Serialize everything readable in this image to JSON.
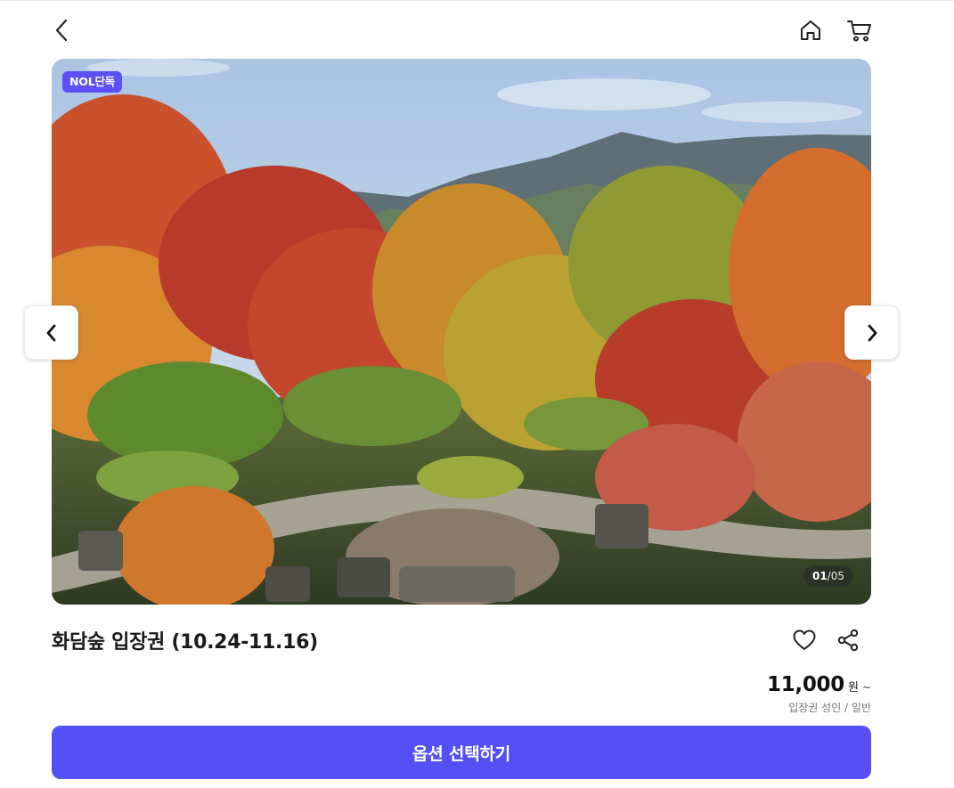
{
  "header": {
    "back_icon": "chevron-left-icon",
    "home_icon": "home-icon",
    "cart_icon": "cart-icon"
  },
  "gallery": {
    "badge": "NOL단독",
    "current": "01",
    "separator": "/",
    "total": "05",
    "prev_icon": "chevron-left-icon",
    "next_icon": "chevron-right-icon"
  },
  "product": {
    "title": "화담숲 입장권 (10.24-11.16)",
    "like_icon": "heart-icon",
    "share_icon": "share-icon",
    "price": "11,000",
    "price_unit": "원",
    "price_suffix": "~",
    "price_desc": "입장권 성인 / 일반"
  },
  "cta": {
    "label": "옵션 선택하기"
  },
  "colors": {
    "accent": "#5550f5",
    "badge": "#5b4ff5"
  }
}
